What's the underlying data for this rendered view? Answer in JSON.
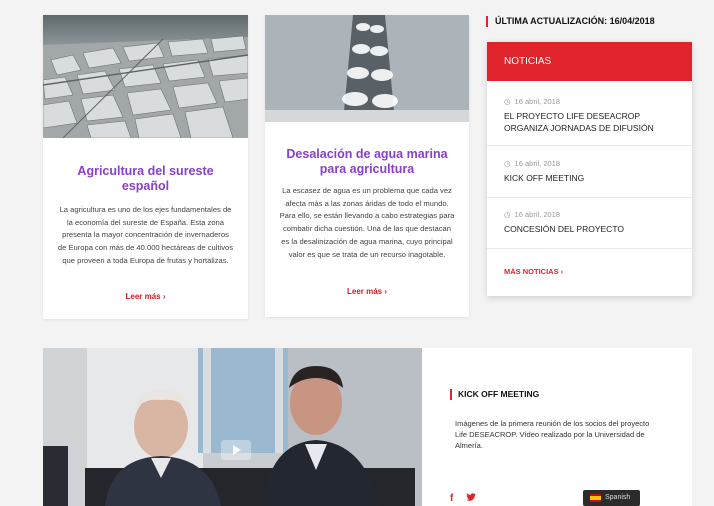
{
  "cards": [
    {
      "title": "Agricultura del sureste español",
      "body": "La agricultura es uno de los ejes fundamentales de la economía del sureste de España. Esta zona presenta la mayor concentración de invernaderos de Europa con más de 40.000 hectáreas de cultivos que proveen a toda Europa de frutas y hortalizas.",
      "more": "Leer más ›"
    },
    {
      "title": "Desalación de agua marina para agricultura",
      "body": "La escasez de agua es un problema que cada vez afecta más a las zonas áridas de todo el mundo. Para ello, se están llevando a cabo estrategias para combatir dicha cuestión. Una de las que destacan es la desalinización de agua marina, cuyo principal valor es que se trata de un recurso inagotable.",
      "more": "Leer más ›"
    }
  ],
  "news": {
    "last_update": "ÚLTIMA ACTUALIZACIÓN: 16/04/2018",
    "header": "NOTICIAS",
    "items": [
      {
        "date": "16 abril, 2018",
        "title": "EL PROYECTO LIFE DESEACROP ORGANIZA JORNADAS DE DIFUSIÓN"
      },
      {
        "date": "16 abril, 2018",
        "title": "KICK OFF MEETING"
      },
      {
        "date": "16 abril, 2018",
        "title": "CONCESIÓN DEL PROYECTO"
      }
    ],
    "more": "MÁS NOTICIAS ›"
  },
  "video": {
    "title": "KICK OFF MEETING",
    "description": "Imágenes de la primera reunión de los socios del proyecto Life DESEACROP. Vídeo realizado por la Universidad de Almería.",
    "facebook": "f",
    "twitter": "🐦"
  },
  "language": {
    "label": "Spanish"
  },
  "colors": {
    "accent": "#e0242b",
    "title_purple": "#8a3fc9"
  }
}
